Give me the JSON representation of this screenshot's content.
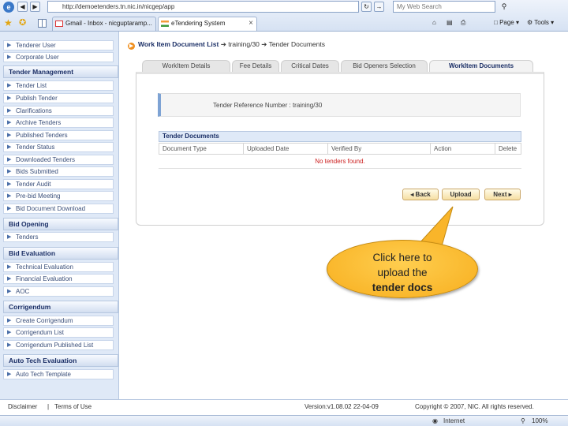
{
  "browser": {
    "address": "http://demoetenders.tn.nic.in/nicgep/app",
    "search_placeholder": "My Web Search",
    "tabs": [
      {
        "label": "Gmail - Inbox - nicguptaramp..."
      },
      {
        "label": "eTendering System"
      }
    ],
    "tools": {
      "page": "Page",
      "tools": "Tools"
    }
  },
  "sidebar": {
    "top_items": [
      "Tenderer User",
      "Corporate User"
    ],
    "sections": [
      {
        "title": "Tender Management",
        "items": [
          "Tender List",
          "Publish Tender",
          "Clarifications",
          "Archive Tenders",
          "Published Tenders",
          "Tender Status",
          "Downloaded Tenders",
          "Bids Submitted",
          "Tender Audit",
          "Pre-bid Meeting",
          "Bid Document Download"
        ]
      },
      {
        "title": "Bid Opening",
        "items": [
          "Tenders"
        ]
      },
      {
        "title": "Bid Evaluation",
        "items": [
          "Technical Evaluation",
          "Financial Evaluation",
          "AOC"
        ]
      },
      {
        "title": "Corrigendum",
        "items": [
          "Create Corrigendum",
          "Corrigendum List",
          "Corrigendum Published List"
        ]
      },
      {
        "title": "Auto Tech Evaluation",
        "items": [
          "Auto Tech Template"
        ]
      }
    ]
  },
  "breadcrumb": {
    "title": "Work Item Document List",
    "sep": "➔",
    "level1": "training/30",
    "level2": "Tender Documents"
  },
  "work_tabs": [
    "WorkItem Details",
    "Fee Details",
    "Critical Dates",
    "Bid Openers Selection",
    "WorkItem Documents"
  ],
  "reference": {
    "label": "Tender Reference Number :",
    "value": "training/30"
  },
  "docs_table": {
    "title": "Tender Documents",
    "columns": [
      "Document Type",
      "Uploaded Date",
      "Verified By",
      "Action",
      "Delete"
    ],
    "empty_message": "No tenders found."
  },
  "buttons": {
    "back": "◂ Back",
    "upload": "Upload",
    "next": "Next ▸"
  },
  "callout": {
    "line1": "Click here to",
    "line2": "upload the",
    "line3": "tender docs"
  },
  "footer": {
    "disclaimer": "Disclaimer",
    "sep": "|",
    "terms": "Terms of Use",
    "version": "Version:v1.08.02 22-04-09",
    "copyright": "Copyright © 2007, NIC. All rights reserved."
  },
  "status_bar": {
    "zone": "Internet",
    "zoom": "100%"
  }
}
